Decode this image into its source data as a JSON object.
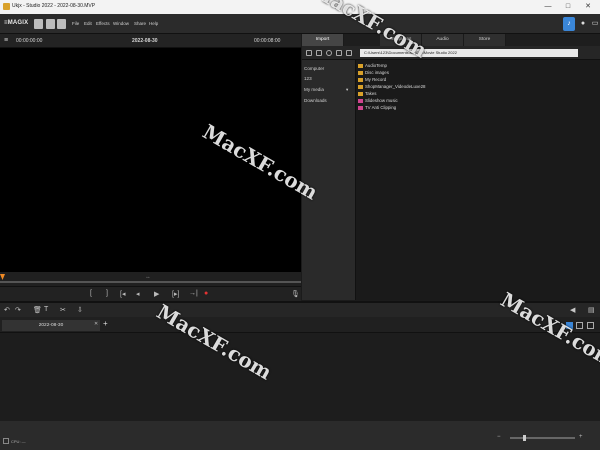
{
  "window": {
    "title": "Ukjx - Studio 2022 - 2022-08-30.MVP",
    "minimize": "—",
    "maximize": "□",
    "close": "✕"
  },
  "brand": "≡MAGIX",
  "menu": [
    "File",
    "Edit",
    "Effects",
    "Window",
    "Share",
    "Help"
  ],
  "preview": {
    "timecode_left": "00:00:00:00",
    "date": "2022-08-30",
    "timecode_right": "00:00:08:00"
  },
  "media": {
    "tabs": [
      "Import",
      "Templates",
      "Audio",
      "Store"
    ],
    "path": "C:\\Users\\123\\Documents\\MAGIX\\Movie Studio 2022",
    "side": [
      "Computer",
      "123",
      "My media",
      "Downloads"
    ],
    "files": [
      {
        "name": "AudioTemp",
        "type": "folder"
      },
      {
        "name": "Disc images",
        "type": "folder"
      },
      {
        "name": "My Record",
        "type": "folder"
      },
      {
        "name": "ShopManager_VideodeLuxe28",
        "type": "folder"
      },
      {
        "name": "Takes",
        "type": "folder"
      },
      {
        "name": "Slideshow music",
        "type": "pink"
      },
      {
        "name": "TV Anti Clipping",
        "type": "pink"
      }
    ]
  },
  "timeline": {
    "movie_tab": "2022-08-30",
    "add": "+"
  },
  "status": {
    "cpu": "CPU: —"
  },
  "watermarks": [
    "MacXF.com",
    "MacXF.com",
    "MacXF.com",
    "MacXF.com"
  ]
}
